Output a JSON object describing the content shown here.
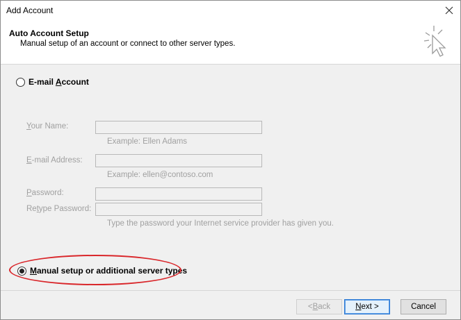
{
  "window": {
    "title": "Add Account",
    "close_icon": "close-icon"
  },
  "header": {
    "title": "Auto Account Setup",
    "subtitle": "Manual setup of an account or connect to other server types.",
    "icon": "wizard-cursor-icon"
  },
  "options": {
    "email_account": {
      "label_pre": "E-mail ",
      "label_key": "A",
      "label_post": "ccount",
      "selected": false
    },
    "manual": {
      "label_pre": "",
      "label_key": "M",
      "label_post": "anual setup or additional server types",
      "selected": true
    }
  },
  "form": {
    "your_name": {
      "label_key": "Y",
      "label_rest": "our Name:",
      "value": "",
      "hint": "Example: Ellen Adams"
    },
    "email": {
      "label_key": "E",
      "label_rest": "-mail Address:",
      "value": "",
      "hint": "Example: ellen@contoso.com"
    },
    "password": {
      "label_key": "P",
      "label_rest": "assword:",
      "value": ""
    },
    "retype": {
      "label_pre": "Re",
      "label_key": "t",
      "label_rest": "ype Password:",
      "value": "",
      "hint": "Type the password your Internet service provider has given you."
    }
  },
  "footer": {
    "back_pre": "< ",
    "back_key": "B",
    "back_rest": "ack",
    "next_key": "N",
    "next_rest": "ext >",
    "cancel": "Cancel"
  },
  "colors": {
    "highlight": "#d9262a",
    "disabled_text": "#a0a0a0",
    "primary_border": "#2a78d4"
  }
}
